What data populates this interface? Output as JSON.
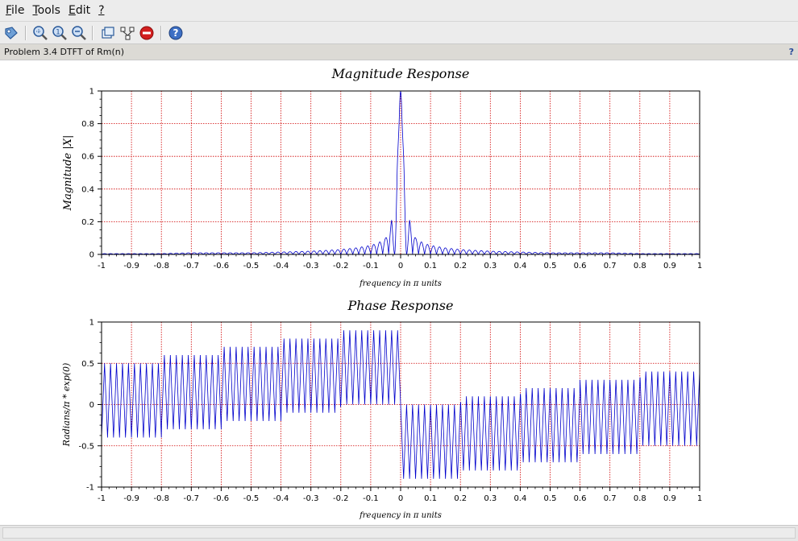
{
  "window": {
    "menu": [
      {
        "name": "menu-file",
        "label_ul": "F",
        "label_rest": "ile"
      },
      {
        "name": "menu-tools",
        "label_ul": "T",
        "label_rest": "ools"
      },
      {
        "name": "menu-edit",
        "label_ul": "E",
        "label_rest": "dit"
      },
      {
        "name": "menu-help",
        "label_ul": "?",
        "label_rest": ""
      }
    ],
    "toolbar_icons": [
      "datatip-icon",
      "zoom-area-icon",
      "zoom-in-icon",
      "zoom-out-icon",
      "rotate-icon",
      "gear-icon",
      "stop-icon",
      "help-icon"
    ],
    "figure_title": "Problem 3.4 DTFT of Rm(n)",
    "help_mark": "?"
  },
  "chart_data": [
    {
      "type": "line",
      "title": "Magnitude Response",
      "xlabel": "frequency in π units",
      "ylabel": "Magnitude |X|",
      "xlim": [
        -1,
        1
      ],
      "ylim": [
        0,
        1
      ],
      "x_ticks": [
        "-1",
        "-0.9",
        "-0.8",
        "-0.7",
        "-0.6",
        "-0.5",
        "-0.4",
        "-0.3",
        "-0.2",
        "-0.1",
        "0",
        "0.1",
        "0.2",
        "0.3",
        "0.4",
        "0.5",
        "0.6",
        "0.7",
        "0.8",
        "0.9",
        "1"
      ],
      "y_ticks": [
        "0",
        "0.2",
        "0.4",
        "0.6",
        "0.8",
        "1"
      ],
      "grid": true,
      "grid_color": "#d00000",
      "series": [
        {
          "color": "#0000cc",
          "x": [
            -1,
            -0.9,
            -0.8,
            -0.7,
            -0.6,
            -0.5,
            -0.4,
            -0.3,
            -0.2,
            -0.15,
            -0.1,
            -0.075,
            -0.05,
            -0.04,
            -0.03,
            -0.02,
            -0.01,
            0,
            0.01,
            0.02,
            0.03,
            0.04,
            0.05,
            0.075,
            0.1,
            0.15,
            0.2,
            0.3,
            0.4,
            0.5,
            0.6,
            0.7,
            0.8,
            0.9,
            1
          ],
          "y": [
            0.005,
            0.005,
            0.005,
            0.01,
            0.01,
            0.01,
            0.015,
            0.02,
            0.03,
            0.04,
            0.055,
            0.07,
            0.1,
            0.14,
            0.21,
            0.02,
            0.6,
            1.0,
            0.6,
            0.02,
            0.21,
            0.14,
            0.1,
            0.07,
            0.055,
            0.04,
            0.03,
            0.02,
            0.015,
            0.01,
            0.01,
            0.01,
            0.005,
            0.005,
            0.005
          ]
        }
      ]
    },
    {
      "type": "line",
      "title": "Phase Response",
      "xlabel": "frequency in π units",
      "ylabel": "Radians/π * exp(0)",
      "xlim": [
        -1,
        1
      ],
      "ylim": [
        -1,
        1
      ],
      "x_ticks": [
        "-1",
        "-0.9",
        "-0.8",
        "-0.7",
        "-0.6",
        "-0.5",
        "-0.4",
        "-0.3",
        "-0.2",
        "-0.1",
        "0",
        "0.1",
        "0.2",
        "0.3",
        "0.4",
        "0.5",
        "0.6",
        "0.7",
        "0.8",
        "0.9",
        "1"
      ],
      "y_ticks": [
        "-1",
        "-0.5",
        "0",
        "0.5",
        "1"
      ],
      "grid": true,
      "grid_color": "#d00000",
      "series": [
        {
          "color": "#0000cc",
          "x": [
            -1,
            -0.8,
            -0.8,
            -0.6,
            -0.6,
            -0.4,
            -0.4,
            -0.2,
            -0.2,
            0,
            0,
            0.2,
            0.2,
            0.4,
            0.4,
            0.6,
            0.6,
            0.8,
            0.8,
            1
          ],
          "y_upper": [
            0.5,
            0.5,
            0.6,
            0.6,
            0.7,
            0.7,
            0.8,
            0.8,
            0.9,
            0.9,
            -0.9,
            -0.9,
            -0.8,
            -0.8,
            -0.7,
            -0.7,
            -0.6,
            -0.6,
            -0.5,
            -0.5
          ],
          "y_lower": [
            -0.4,
            -0.4,
            -0.3,
            -0.3,
            -0.2,
            -0.2,
            -0.1,
            -0.1,
            0.0,
            0.0,
            0.0,
            0.0,
            0.1,
            0.1,
            0.2,
            0.2,
            0.3,
            0.3,
            0.4,
            0.4
          ]
        }
      ]
    }
  ]
}
